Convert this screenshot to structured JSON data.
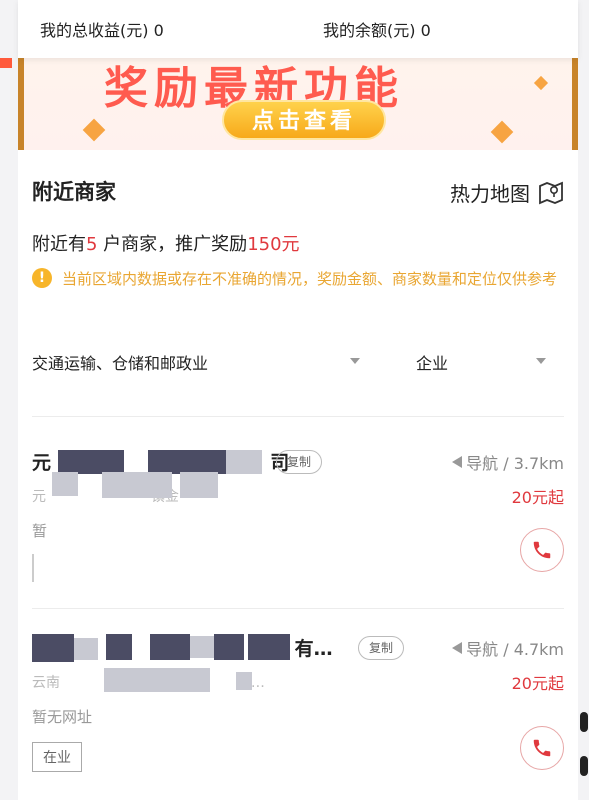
{
  "summary": {
    "total_income": "我的总收益(元) 0",
    "balance": "我的余额(元) 0"
  },
  "banner": {
    "headline": "奖励最新功能",
    "button_label": "点击查看"
  },
  "nearby": {
    "title": "附近商家",
    "heatmap_label": "热力地图",
    "count_prefix": "附近有",
    "count": "5",
    "count_mid": " 户商家，推广奖励",
    "reward": "150元",
    "notice": "当前区域内数据或存在不准确的情况，奖励金额、商家数量和定位仅供参考"
  },
  "filters": {
    "industry": "交通运输、仓储和邮政业",
    "type": "企业"
  },
  "merchants": [
    {
      "name_start": "元",
      "name_end": "司",
      "copy": "复制",
      "navigate": "导航 / 3.7km",
      "address_start": "元",
      "address_mid": "镇金",
      "price": "20元起",
      "website": "暂"
    },
    {
      "name_end": "有…",
      "copy": "复制",
      "navigate": "导航 / 4.7km",
      "address_start": "云南",
      "address_end": "县…",
      "price": "20元起",
      "website": "暂无网址",
      "status": "在业"
    }
  ],
  "colors": {
    "accent_red": "#e0393e",
    "notice_yellow": "#e9a632",
    "banner_orange": "#f7a91a"
  }
}
